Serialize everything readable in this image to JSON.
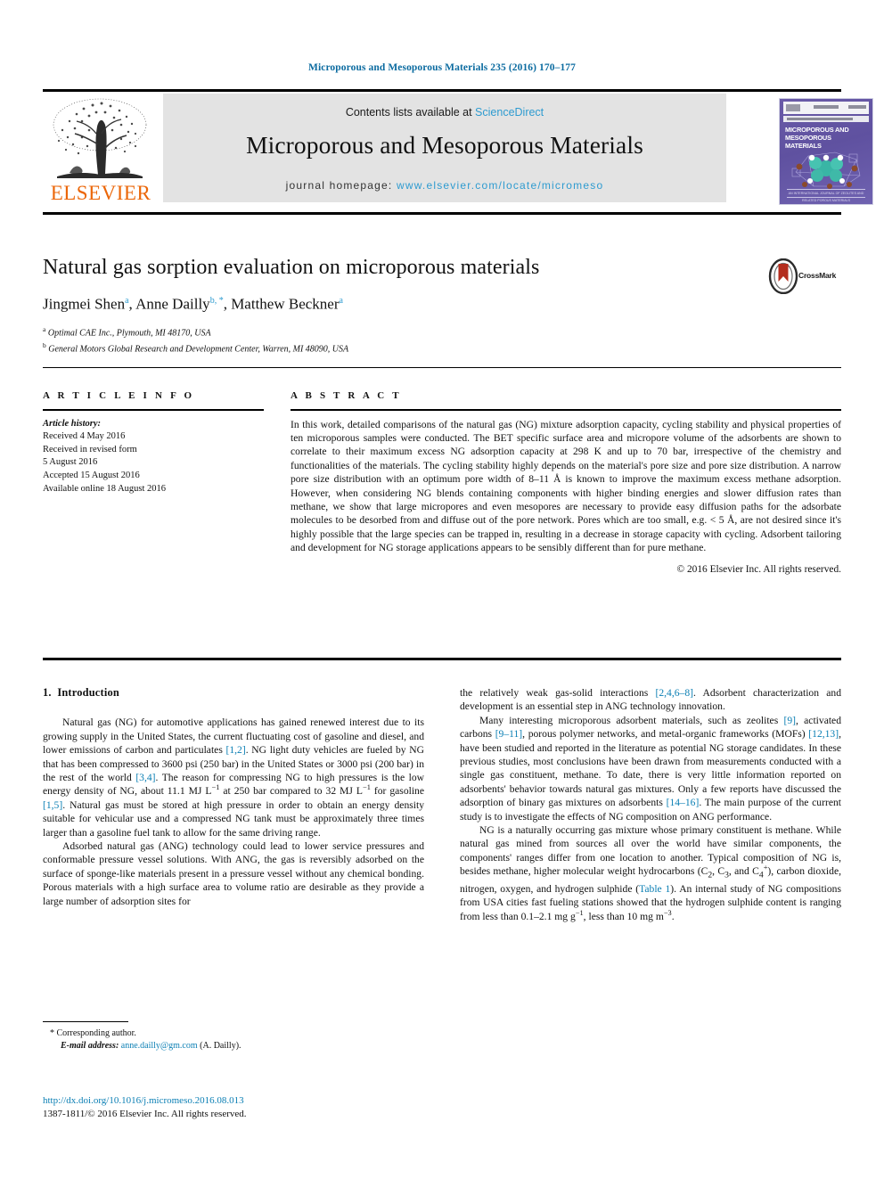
{
  "running_head": "Microporous and Mesoporous Materials 235 (2016) 170–177",
  "masthead": {
    "contents_prefix": "Contents lists available at ",
    "contents_link": "ScienceDirect",
    "journal_title": "Microporous and Mesoporous Materials",
    "homepage_prefix": "journal homepage: ",
    "homepage_link": "www.elsevier.com/locate/micromeso",
    "publisher_name": "ELSEVIER",
    "cover_title": "MICROPOROUS AND MESOPOROUS MATERIALS",
    "cover_footer": "AN INTERNATIONAL JOURNAL OF ZEOLITES AND RELATED POROUS MATERIALS"
  },
  "article": {
    "title": "Natural gas sorption evaluation on microporous materials",
    "authors": [
      {
        "name": "Jingmei Shen",
        "marks": "a",
        "sep": ", "
      },
      {
        "name": "Anne Dailly",
        "marks": "b, *",
        "sep": ", "
      },
      {
        "name": "Matthew Beckner",
        "marks": "a",
        "sep": ""
      }
    ],
    "affiliations": [
      {
        "mark": "a",
        "text": "Optimal CAE Inc., Plymouth, MI 48170, USA"
      },
      {
        "mark": "b",
        "text": "General Motors Global Research and Development Center, Warren, MI 48090, USA"
      }
    ],
    "crossmark_label": "CrossMark"
  },
  "info": {
    "heading": "A R T I C L E  I N F O",
    "history_label": "Article history:",
    "lines": [
      "Received 4 May 2016",
      "Received in revised form",
      "5 August 2016",
      "Accepted 15 August 2016",
      "Available online 18 August 2016"
    ]
  },
  "abstract": {
    "heading": "A B S T R A C T",
    "text": "In this work, detailed comparisons of the natural gas (NG) mixture adsorption capacity, cycling stability and physical properties of ten microporous samples were conducted. The BET specific surface area and micropore volume of the adsorbents are shown to correlate to their maximum excess NG adsorption capacity at 298 K and up to 70 bar, irrespective of the chemistry and functionalities of the materials. The cycling stability highly depends on the material's pore size and pore size distribution. A narrow pore size distribution with an optimum pore width of 8–11 Å is known to improve the maximum excess methane adsorption. However, when considering NG blends containing components with higher binding energies and slower diffusion rates than methane, we show that large micropores and even mesopores are necessary to provide easy diffusion paths for the adsorbate molecules to be desorbed from and diffuse out of the pore network. Pores which are too small, e.g. < 5 Å, are not desired since it's highly possible that the large species can be trapped in, resulting in a decrease in storage capacity with cycling. Adsorbent tailoring and development for NG storage applications appears to be sensibly different than for pure methane.",
    "copyright": "© 2016 Elsevier Inc. All rights reserved."
  },
  "body": {
    "section_number": "1.",
    "section_title": "Introduction",
    "left_paragraphs": [
      "Natural gas (NG) for automotive applications has gained renewed interest due to its growing supply in the United States, the current fluctuating cost of gasoline and diesel, and lower emissions of carbon and particulates [1,2]. NG light duty vehicles are fueled by NG that has been compressed to 3600 psi (250 bar) in the United States or 3000 psi (200 bar) in the rest of the world [3,4]. The reason for compressing NG to high pressures is the low energy density of NG, about 11.1 MJ L−1 at 250 bar compared to 32 MJ L−1 for gasoline [1,5]. Natural gas must be stored at high pressure in order to obtain an energy density suitable for vehicular use and a compressed NG tank must be approximately three times larger than a gasoline fuel tank to allow for the same driving range.",
      "Adsorbed natural gas (ANG) technology could lead to lower service pressures and conformable pressure vessel solutions. With ANG, the gas is reversibly adsorbed on the surface of sponge-like materials present in a pressure vessel without any chemical bonding. Porous materials with a high surface area to volume ratio are desirable as they provide a large number of adsorption sites for"
    ],
    "right_paragraphs": [
      "the relatively weak gas-solid interactions [2,4,6–8]. Adsorbent characterization and development is an essential step in ANG technology innovation.",
      "Many interesting microporous adsorbent materials, such as zeolites [9], activated carbons [9–11], porous polymer networks, and metal-organic frameworks (MOFs) [12,13], have been studied and reported in the literature as potential NG storage candidates. In these previous studies, most conclusions have been drawn from measurements conducted with a single gas constituent, methane. To date, there is very little information reported on adsorbents' behavior towards natural gas mixtures. Only a few reports have discussed the adsorption of binary gas mixtures on adsorbents [14–16]. The main purpose of the current study is to investigate the effects of NG composition on ANG performance.",
      "NG is a naturally occurring gas mixture whose primary constituent is methane. While natural gas mined from sources all over the world have similar components, the components' ranges differ from one location to another. Typical composition of NG is, besides methane, higher molecular weight hydrocarbons (C2, C3, and C4+), carbon dioxide, nitrogen, oxygen, and hydrogen sulphide (Table 1). An internal study of NG compositions from USA cities fast fueling stations showed that the hydrogen sulphide content is ranging from less than 0.1–2.1 mg g−1, less than 10 mg m−3."
    ]
  },
  "footnote": {
    "corresponding": "* Corresponding author.",
    "email_label": "E-mail address:",
    "email": "anne.dailly@gm.com",
    "email_suffix": "(A. Dailly)."
  },
  "imprint": {
    "doi": "http://dx.doi.org/10.1016/j.micromeso.2016.08.013",
    "issn_line": "1387-1811/© 2016 Elsevier Inc. All rights reserved."
  },
  "colors": {
    "link_blue": "#2e9bd0",
    "cite_blue": "#0b7fb4",
    "head_blue": "#0b6ba0",
    "elsevier_orange": "#eb6608",
    "band_gray": "#e3e3e3"
  }
}
